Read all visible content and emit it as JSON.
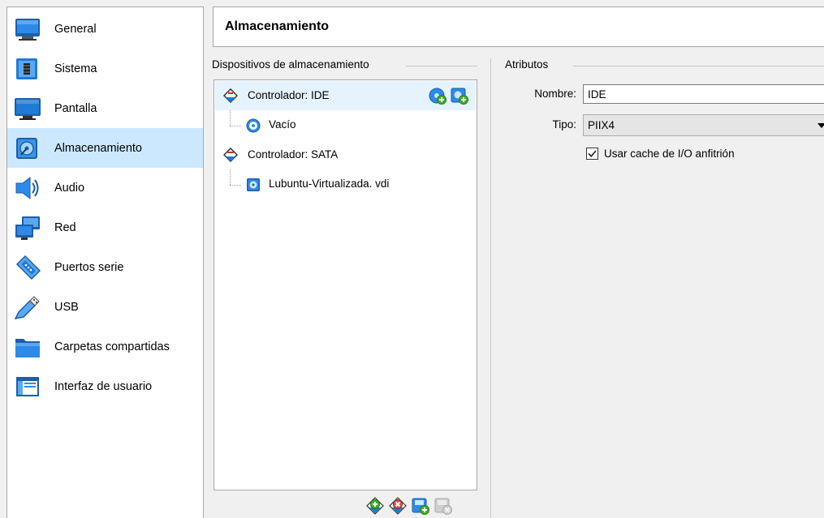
{
  "sidebar": {
    "items": [
      {
        "label": "General",
        "icon": "monitor-general-icon"
      },
      {
        "label": "Sistema",
        "icon": "chip-icon"
      },
      {
        "label": "Pantalla",
        "icon": "display-icon"
      },
      {
        "label": "Almacenamiento",
        "icon": "storage-disk-icon",
        "selected": true
      },
      {
        "label": "Audio",
        "icon": "speaker-icon"
      },
      {
        "label": "Red",
        "icon": "network-icon"
      },
      {
        "label": "Puertos serie",
        "icon": "serial-port-icon"
      },
      {
        "label": "USB",
        "icon": "usb-icon"
      },
      {
        "label": "Carpetas compartidas",
        "icon": "folder-icon"
      },
      {
        "label": "Interfaz de usuario",
        "icon": "window-ui-icon"
      }
    ]
  },
  "header": {
    "title": "Almacenamiento"
  },
  "storage": {
    "group_title": "Dispositivos de almacenamiento",
    "tree": [
      {
        "label": "Controlador: IDE",
        "type": "controller",
        "icon": "ide-controller-icon",
        "selected": true
      },
      {
        "label": "Vacío",
        "type": "optical",
        "icon": "optical-disc-icon"
      },
      {
        "label": "Controlador: SATA",
        "type": "controller",
        "icon": "sata-controller-icon"
      },
      {
        "label": "Lubuntu-Virtualizada. vdi",
        "type": "disk",
        "icon": "hard-disk-icon"
      }
    ],
    "row_actions": [
      "add-optical-drive-icon",
      "add-hard-disk-icon"
    ],
    "bottom_actions": [
      "add-controller-icon",
      "remove-controller-icon",
      "add-attachment-icon",
      "remove-attachment-icon"
    ]
  },
  "attributes": {
    "group_title": "Atributos",
    "name_label": "Nombre:",
    "name_value": "IDE",
    "type_label": "Tipo:",
    "type_value": "PIIX4",
    "host_cache_label": "Usar cache de I/O anfitrión",
    "host_cache_checked": true
  },
  "colors": {
    "selection": "#cce8ff",
    "tree_selection": "#e5f3ff",
    "icon_blue": "#1e7bd6",
    "icon_green": "#3fae2a"
  }
}
